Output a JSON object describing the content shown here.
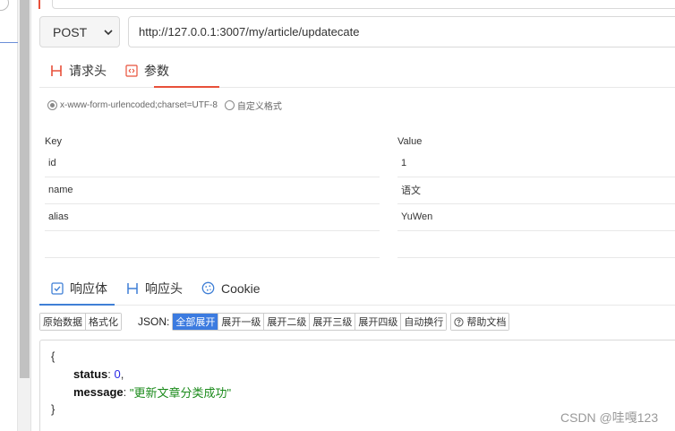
{
  "request": {
    "method": "POST",
    "url": "http://127.0.0.1:3007/my/article/updatecate",
    "tabs": [
      {
        "label": "请求头"
      },
      {
        "label": "参数"
      }
    ],
    "encoding_options": [
      {
        "label": "x-www-form-urlencoded;charset=UTF-8"
      },
      {
        "label": "自定义格式"
      }
    ]
  },
  "params": {
    "key_header": "Key",
    "value_header": "Value",
    "rows": [
      {
        "key": "id",
        "value": "1"
      },
      {
        "key": "name",
        "value": "语文"
      },
      {
        "key": "alias",
        "value": "YuWen"
      },
      {
        "key": "",
        "value": ""
      }
    ]
  },
  "response": {
    "tabs": [
      {
        "label": "响应体"
      },
      {
        "label": "响应头"
      },
      {
        "label": "Cookie"
      }
    ],
    "view_buttons": [
      "原始数据",
      "格式化"
    ],
    "json_label": "JSON:",
    "expand_buttons": [
      "全部展开",
      "展开一级",
      "展开二级",
      "展开三级",
      "展开四级",
      "自动换行"
    ],
    "help_label": "帮助文档",
    "body": {
      "open_brace": "{",
      "close_brace": "}",
      "fields": [
        {
          "key": "status",
          "value": "0",
          "sep": ": ",
          "trail": ","
        },
        {
          "key": "message",
          "value": "\"更新文章分类成功\"",
          "sep": ": ",
          "trail": ""
        }
      ]
    }
  },
  "watermark": "CSDN @哇嘎123",
  "colors": {
    "accent_red": "#e8503a",
    "accent_blue": "#3c7be0"
  }
}
